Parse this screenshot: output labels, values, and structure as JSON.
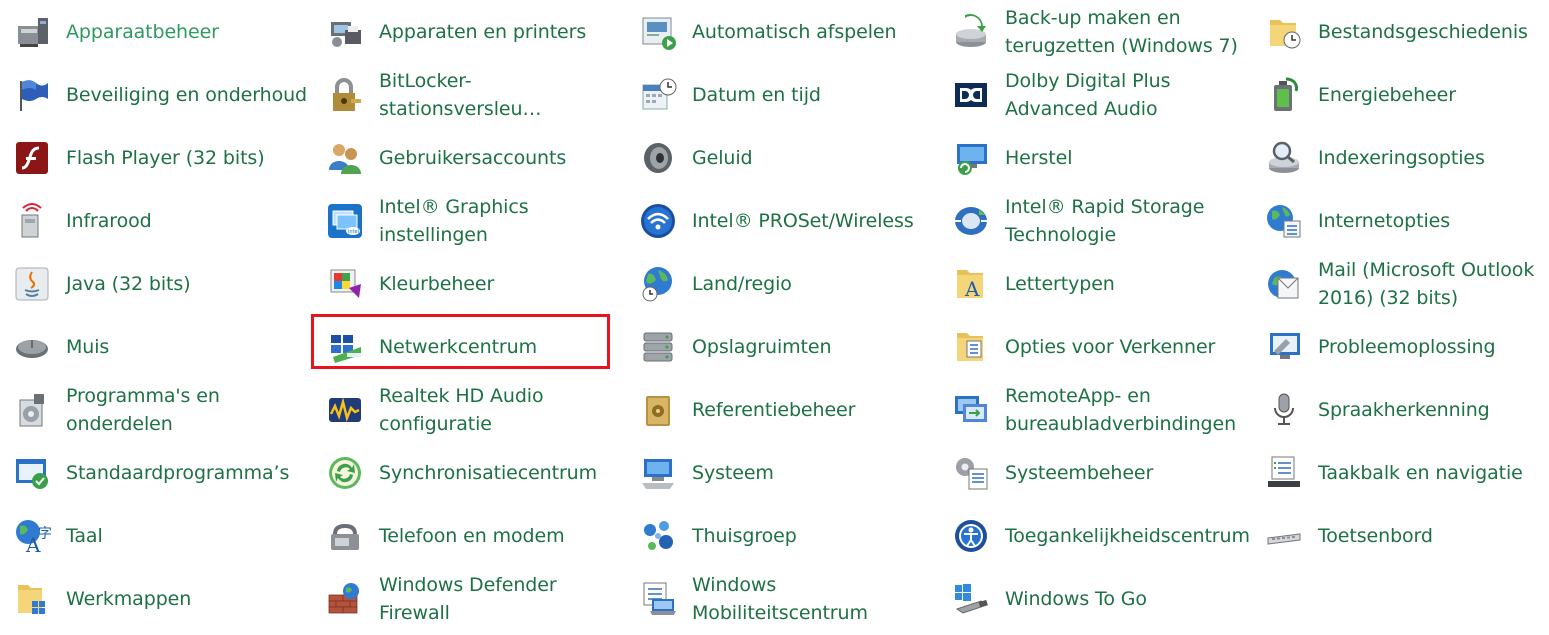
{
  "highlight_color": "#e8131c",
  "link_color": "#1e7145",
  "items": [
    {
      "label": "Apparaatbeheer",
      "icon": "device-manager-icon"
    },
    {
      "label": "Apparaten en printers",
      "icon": "devices-printers-icon"
    },
    {
      "label": "Automatisch afspelen",
      "icon": "autoplay-icon"
    },
    {
      "label": "Back-up maken en\nterugzetten (Windows 7)",
      "icon": "backup-restore-icon"
    },
    {
      "label": "Bestandsgeschiedenis",
      "icon": "file-history-icon"
    },
    {
      "label": "Beveiliging en onderhoud",
      "icon": "security-flag-icon"
    },
    {
      "label": "BitLocker-stationsversleu…",
      "icon": "bitlocker-icon"
    },
    {
      "label": "Datum en tijd",
      "icon": "date-time-icon"
    },
    {
      "label": "Dolby Digital Plus\nAdvanced Audio",
      "icon": "dolby-icon"
    },
    {
      "label": "Energiebeheer",
      "icon": "power-options-icon"
    },
    {
      "label": "Flash Player (32 bits)",
      "icon": "flash-player-icon"
    },
    {
      "label": "Gebruikersaccounts",
      "icon": "user-accounts-icon"
    },
    {
      "label": "Geluid",
      "icon": "sound-icon"
    },
    {
      "label": "Herstel",
      "icon": "recovery-icon"
    },
    {
      "label": "Indexeringsopties",
      "icon": "indexing-icon"
    },
    {
      "label": "Infrarood",
      "icon": "infrared-icon"
    },
    {
      "label": "Intel® Graphics\ninstellingen",
      "icon": "intel-graphics-icon"
    },
    {
      "label": "Intel® PROSet/Wireless",
      "icon": "intel-wireless-icon"
    },
    {
      "label": "Intel® Rapid Storage\nTechnologie",
      "icon": "intel-rapid-storage-icon"
    },
    {
      "label": "Internetopties",
      "icon": "internet-options-icon"
    },
    {
      "label": "Java (32 bits)",
      "icon": "java-icon"
    },
    {
      "label": "Kleurbeheer",
      "icon": "color-management-icon"
    },
    {
      "label": "Land/regio",
      "icon": "region-icon"
    },
    {
      "label": "Lettertypen",
      "icon": "fonts-icon"
    },
    {
      "label": "Mail (Microsoft Outlook\n2016) (32 bits)",
      "icon": "mail-icon"
    },
    {
      "label": "Muis",
      "icon": "mouse-icon"
    },
    {
      "label": "Netwerkcentrum",
      "icon": "network-center-icon"
    },
    {
      "label": "Opslagruimten",
      "icon": "storage-spaces-icon"
    },
    {
      "label": "Opties voor Verkenner",
      "icon": "explorer-options-icon"
    },
    {
      "label": "Probleemoplossing",
      "icon": "troubleshooting-icon"
    },
    {
      "label": "Programma's en\nonderdelen",
      "icon": "programs-features-icon"
    },
    {
      "label": "Realtek HD Audio\nconfiguratie",
      "icon": "realtek-audio-icon"
    },
    {
      "label": "Referentiebeheer",
      "icon": "credential-manager-icon"
    },
    {
      "label": "RemoteApp- en\nbureaubladverbindingen",
      "icon": "remoteapp-icon"
    },
    {
      "label": "Spraakherkenning",
      "icon": "microphone-icon"
    },
    {
      "label": "Standaardprogramma’s",
      "icon": "default-programs-icon"
    },
    {
      "label": "Synchronisatiecentrum",
      "icon": "sync-center-icon"
    },
    {
      "label": "Systeem",
      "icon": "system-icon"
    },
    {
      "label": "Systeembeheer",
      "icon": "admin-tools-icon"
    },
    {
      "label": "Taakbalk en navigatie",
      "icon": "taskbar-icon"
    },
    {
      "label": "Taal",
      "icon": "language-icon"
    },
    {
      "label": "Telefoon en modem",
      "icon": "phone-modem-icon"
    },
    {
      "label": "Thuisgroep",
      "icon": "homegroup-icon"
    },
    {
      "label": "Toegankelijkheidscentrum",
      "icon": "ease-of-access-icon"
    },
    {
      "label": "Toetsenbord",
      "icon": "keyboard-icon"
    },
    {
      "label": "Werkmappen",
      "icon": "work-folders-icon"
    },
    {
      "label": "Windows Defender\nFirewall",
      "icon": "firewall-icon"
    },
    {
      "label": "Windows\nMobiliteitscentrum",
      "icon": "mobility-center-icon"
    },
    {
      "label": "Windows To Go",
      "icon": "windows-to-go-icon"
    }
  ]
}
